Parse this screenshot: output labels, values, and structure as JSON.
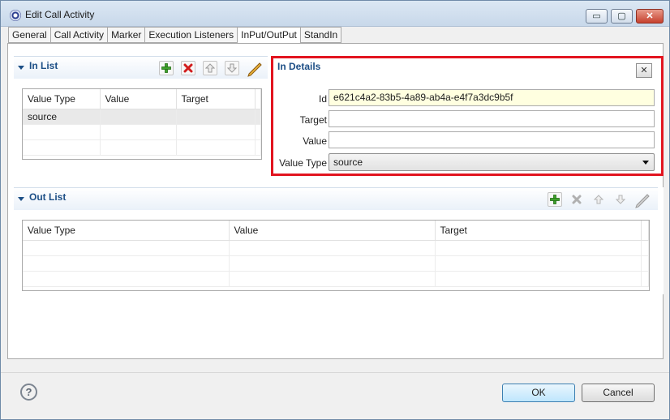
{
  "window": {
    "title": "Edit Call Activity",
    "min_glyph": "▭",
    "max_glyph": "▢",
    "close_glyph": "✕"
  },
  "tabs": [
    "General",
    "Call Activity",
    "Marker",
    "Execution Listeners",
    "InPut/OutPut",
    "StandIn"
  ],
  "active_tab": "InPut/OutPut",
  "in_list": {
    "title": "In List",
    "columns": [
      "Value Type",
      "Value",
      "Target"
    ],
    "rows": [
      [
        "source",
        "",
        ""
      ]
    ],
    "toolbar": [
      "add-icon",
      "delete-icon",
      "move-up-icon",
      "move-down-icon",
      "edit-icon"
    ]
  },
  "in_details": {
    "title": "In Details",
    "fields": {
      "id_label": "Id",
      "id_value": "e621c4a2-83b5-4a89-ab4a-e4f7a3dc9b5f",
      "target_label": "Target",
      "target_value": "",
      "value_label": "Value",
      "value_value": "",
      "value_type_label": "Value Type",
      "value_type_value": "source"
    },
    "highlight_color": "#e2141f"
  },
  "out_list": {
    "title": "Out List",
    "columns": [
      "Value Type",
      "Value",
      "Target"
    ],
    "rows": [],
    "toolbar": [
      "add-icon",
      "delete-icon",
      "move-up-icon",
      "move-down-icon",
      "edit-icon"
    ]
  },
  "footer": {
    "help_glyph": "?",
    "ok_label": "OK",
    "cancel_label": "Cancel"
  }
}
